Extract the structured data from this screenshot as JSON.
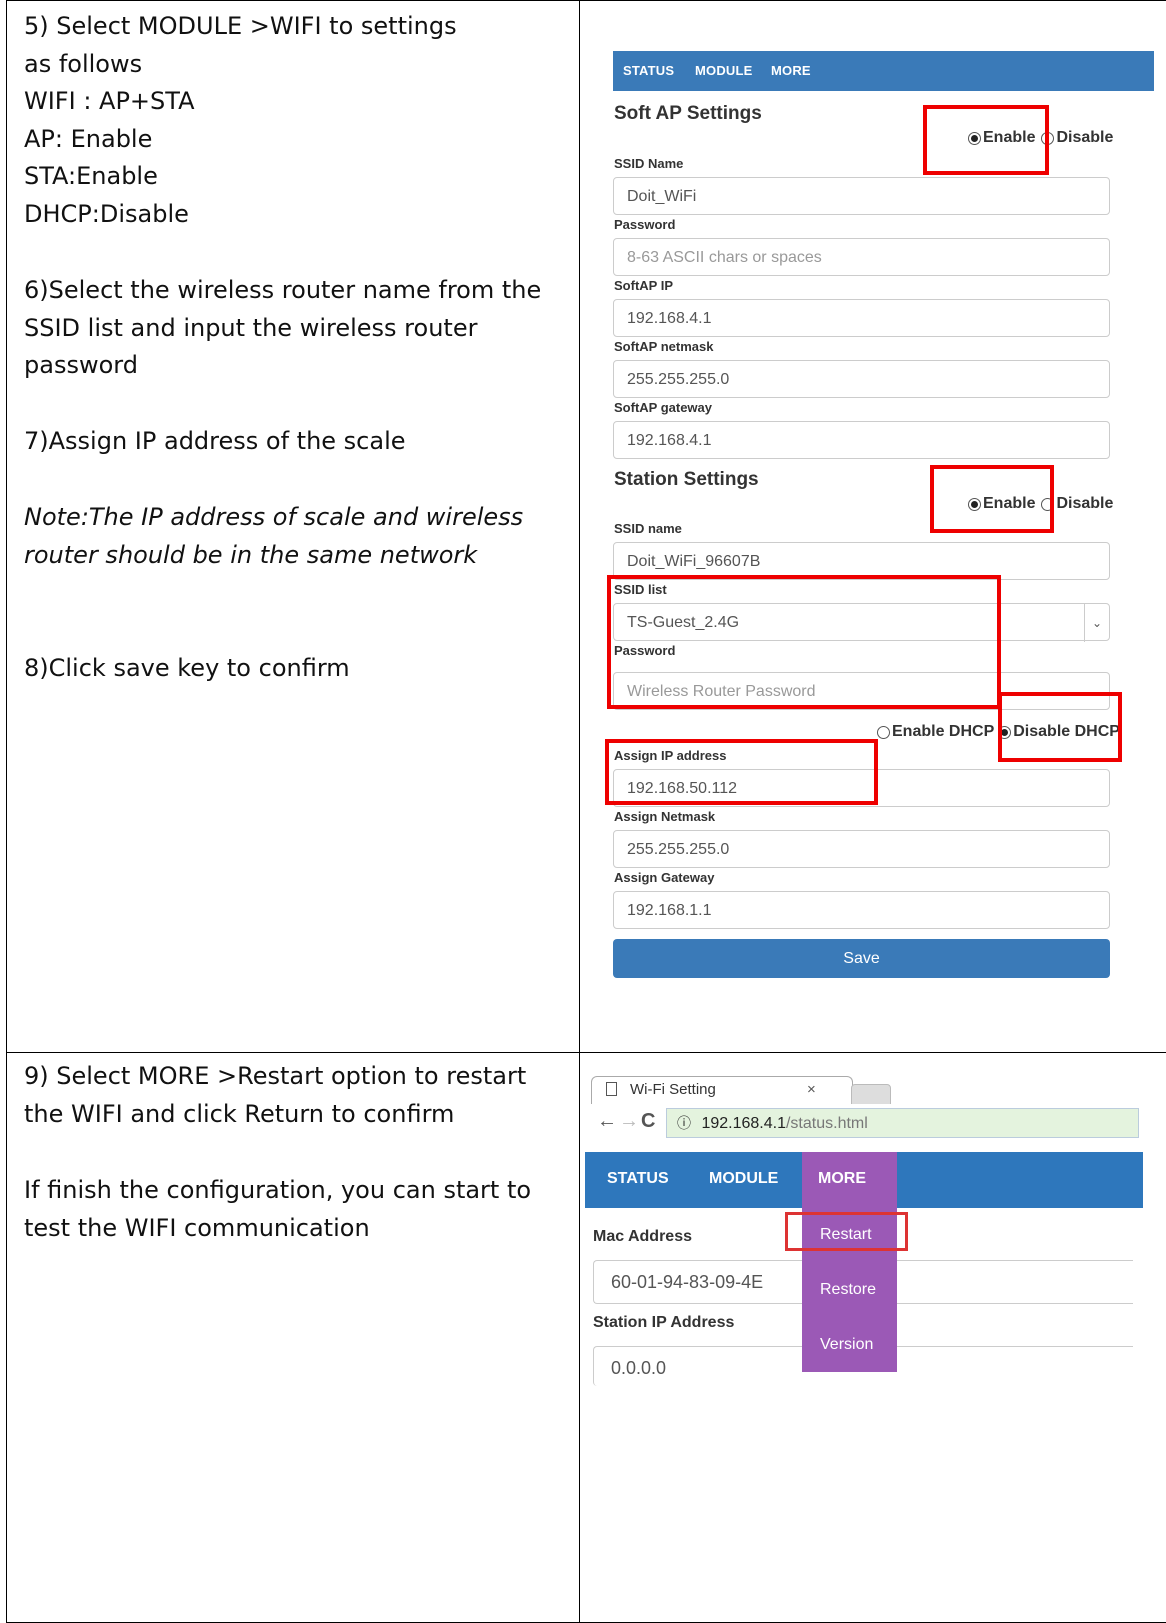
{
  "step_a": {
    "lines": [
      "5) Select MODULE >WIFI to settings",
      "as follows",
      "WIFI : AP+STA",
      "AP: Enable",
      "STA:Enable",
      "DHCP:Disable"
    ],
    "step6": [
      "6)Select the wireless router name from the",
      "SSID list and input the wireless router",
      "password"
    ],
    "step7": "7)Assign IP address of the scale",
    "note": [
      "Note:The IP address of scale and wireless",
      "router should be in the same network"
    ],
    "step8": "8)Click save key to confirm"
  },
  "step_b": {
    "step9": [
      "9) Select MORE >Restart option to restart",
      "the WIFI and click Return to confirm"
    ],
    "finish": [
      "If finish the configuration, you can start to",
      "test the WIFI communication"
    ]
  },
  "wifi_form": {
    "nav": [
      "STATUS",
      "MODULE",
      "MORE"
    ],
    "soft_ap_title": "Soft AP Settings",
    "enable_label": "Enable",
    "disable_label": "Disable",
    "ssid_name_label": "SSID Name",
    "ssid_name_value": "Doit_WiFi",
    "password_label": "Password",
    "password_placeholder": "8-63 ASCII chars or spaces",
    "softap_ip_label": "SoftAP IP",
    "softap_ip_value": "192.168.4.1",
    "softap_netmask_label": "SoftAP netmask",
    "softap_netmask_value": "255.255.255.0",
    "softap_gateway_label": "SoftAP gateway",
    "softap_gateway_value": "192.168.4.1",
    "station_title": "Station Settings",
    "station_ssid_label": "SSID name",
    "station_ssid_value": "Doit_WiFi_96607B",
    "ssid_list_label": "SSID list",
    "ssid_list_value": "TS-Guest_2.4G",
    "station_password_label": "Password",
    "station_password_placeholder": "Wireless Router Password",
    "enable_dhcp": "Enable DHCP",
    "disable_dhcp": "Disable DHCP",
    "assign_ip_label": "Assign IP address",
    "assign_ip_value": "192.168.50.112",
    "assign_netmask_label": "Assign Netmask",
    "assign_netmask_value": "255.255.255.0",
    "assign_gateway_label": "Assign Gateway",
    "assign_gateway_value": "192.168.1.1",
    "save_label": "Save",
    "highlight_color": "#e00000"
  },
  "browser": {
    "tab_title": "Wi-Fi Setting",
    "tab_close": "×",
    "url_host": "192.168.4.1",
    "url_path": "/status.html",
    "nav": [
      "STATUS",
      "MODULE",
      "MORE"
    ],
    "menu": [
      "Restart",
      "Restore",
      "Version"
    ],
    "mac_label": "Mac Address",
    "mac_value": "60-01-94-83-09-4E",
    "station_ip_label": "Station IP Address",
    "station_ip_value": "0.0.0.0",
    "accent_nav": "#2e77bc",
    "accent_menu": "#9b59b6"
  }
}
